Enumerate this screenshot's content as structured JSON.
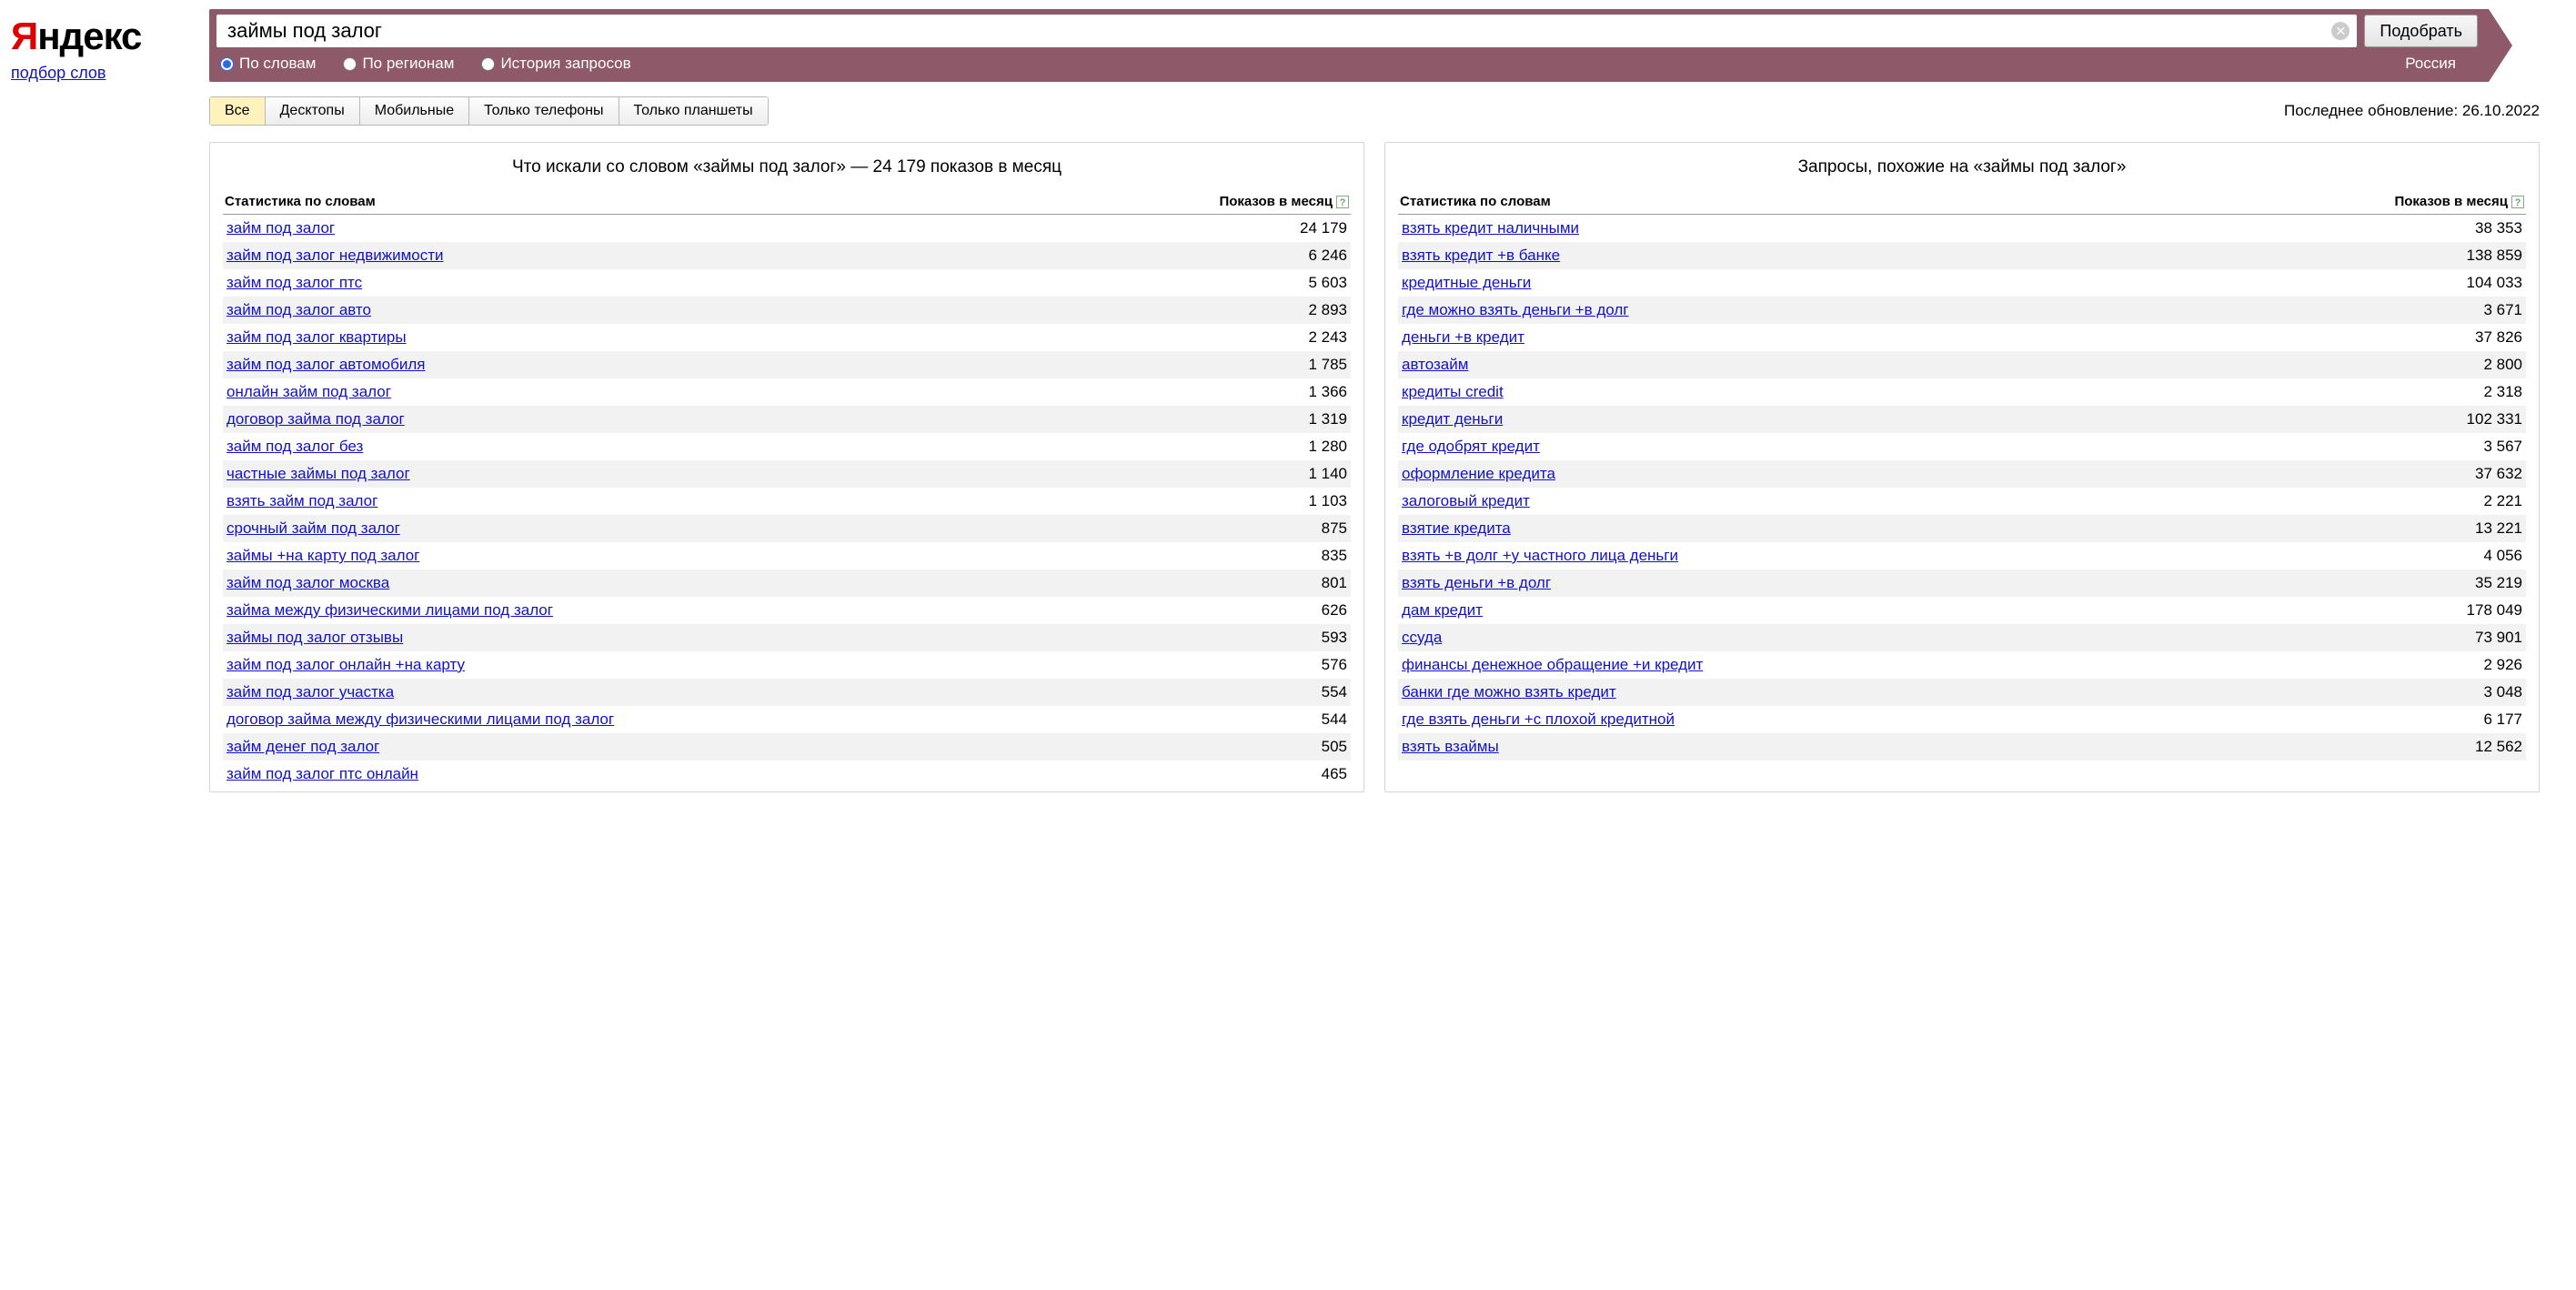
{
  "logo": {
    "ya": "Я",
    "ndex": "ндекс"
  },
  "subservice_label": "подбор слов",
  "search": {
    "value": "займы под залог",
    "submit_label": "Подобрать",
    "clear_tooltip": "Очистить"
  },
  "modes": {
    "by_words": "По словам",
    "by_regions": "По регионам",
    "history": "История запросов",
    "selected": "by_words",
    "region": "Россия"
  },
  "filters": {
    "tabs": [
      "Все",
      "Десктопы",
      "Мобильные",
      "Только телефоны",
      "Только планшеты"
    ],
    "active_index": 0
  },
  "last_update_label": "Последнее обновление: 26.10.2022",
  "panel_left": {
    "title": "Что искали со словом «займы под залог» — 24 179 показов в месяц",
    "col_left": "Статистика по словам",
    "col_right": "Показов в месяц",
    "rows": [
      {
        "word": "займ под залог",
        "count": "24 179"
      },
      {
        "word": "займ под залог недвижимости",
        "count": "6 246"
      },
      {
        "word": "займ под залог птс",
        "count": "5 603"
      },
      {
        "word": "займ под залог авто",
        "count": "2 893"
      },
      {
        "word": "займ под залог квартиры",
        "count": "2 243"
      },
      {
        "word": "займ под залог автомобиля",
        "count": "1 785"
      },
      {
        "word": "онлайн займ под залог",
        "count": "1 366"
      },
      {
        "word": "договор займа под залог",
        "count": "1 319"
      },
      {
        "word": "займ под залог без",
        "count": "1 280"
      },
      {
        "word": "частные займы под залог",
        "count": "1 140"
      },
      {
        "word": "взять займ под залог",
        "count": "1 103"
      },
      {
        "word": "срочный займ под залог",
        "count": "875"
      },
      {
        "word": "займы +на карту под залог",
        "count": "835"
      },
      {
        "word": "займ под залог москва",
        "count": "801"
      },
      {
        "word": "займа между физическими лицами под залог",
        "count": "626"
      },
      {
        "word": "займы под залог отзывы",
        "count": "593"
      },
      {
        "word": "займ под залог онлайн +на карту",
        "count": "576"
      },
      {
        "word": "займ под залог участка",
        "count": "554"
      },
      {
        "word": "договор займа между физическими лицами под залог",
        "count": "544"
      },
      {
        "word": "займ денег под залог",
        "count": "505"
      },
      {
        "word": "займ под залог птс онлайн",
        "count": "465"
      }
    ]
  },
  "panel_right": {
    "title": "Запросы, похожие на «займы под залог»",
    "col_left": "Статистика по словам",
    "col_right": "Показов в месяц",
    "rows": [
      {
        "word": "взять кредит наличными",
        "count": "38 353"
      },
      {
        "word": "взять кредит +в банке",
        "count": "138 859"
      },
      {
        "word": "кредитные деньги",
        "count": "104 033"
      },
      {
        "word": "где можно взять деньги +в долг",
        "count": "3 671"
      },
      {
        "word": "деньги +в кредит",
        "count": "37 826"
      },
      {
        "word": "автозайм",
        "count": "2 800"
      },
      {
        "word": "кредиты credit",
        "count": "2 318"
      },
      {
        "word": "кредит деньги",
        "count": "102 331"
      },
      {
        "word": "где одобрят кредит",
        "count": "3 567"
      },
      {
        "word": "оформление кредита",
        "count": "37 632"
      },
      {
        "word": "залоговый кредит",
        "count": "2 221"
      },
      {
        "word": "взятие кредита",
        "count": "13 221"
      },
      {
        "word": "взять +в долг +у частного лица деньги",
        "count": "4 056"
      },
      {
        "word": "взять деньги +в долг",
        "count": "35 219"
      },
      {
        "word": "дам кредит",
        "count": "178 049"
      },
      {
        "word": "ссуда",
        "count": "73 901"
      },
      {
        "word": "финансы денежное обращение +и кредит",
        "count": "2 926"
      },
      {
        "word": "банки где можно взять кредит",
        "count": "3 048"
      },
      {
        "word": "где взять деньги +с плохой кредитной",
        "count": "6 177"
      },
      {
        "word": "взять взаймы",
        "count": "12 562"
      }
    ]
  },
  "help_tooltip": "?"
}
